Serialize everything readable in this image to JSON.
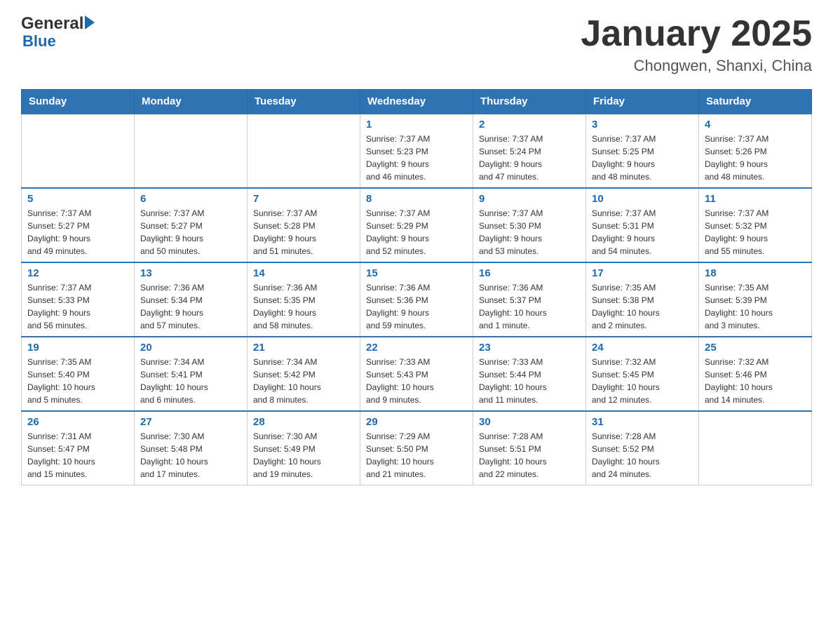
{
  "header": {
    "logo_general": "General",
    "logo_blue": "Blue",
    "month_title": "January 2025",
    "location": "Chongwen, Shanxi, China"
  },
  "days_of_week": [
    "Sunday",
    "Monday",
    "Tuesday",
    "Wednesday",
    "Thursday",
    "Friday",
    "Saturday"
  ],
  "weeks": [
    [
      {
        "day": "",
        "info": ""
      },
      {
        "day": "",
        "info": ""
      },
      {
        "day": "",
        "info": ""
      },
      {
        "day": "1",
        "info": "Sunrise: 7:37 AM\nSunset: 5:23 PM\nDaylight: 9 hours\nand 46 minutes."
      },
      {
        "day": "2",
        "info": "Sunrise: 7:37 AM\nSunset: 5:24 PM\nDaylight: 9 hours\nand 47 minutes."
      },
      {
        "day": "3",
        "info": "Sunrise: 7:37 AM\nSunset: 5:25 PM\nDaylight: 9 hours\nand 48 minutes."
      },
      {
        "day": "4",
        "info": "Sunrise: 7:37 AM\nSunset: 5:26 PM\nDaylight: 9 hours\nand 48 minutes."
      }
    ],
    [
      {
        "day": "5",
        "info": "Sunrise: 7:37 AM\nSunset: 5:27 PM\nDaylight: 9 hours\nand 49 minutes."
      },
      {
        "day": "6",
        "info": "Sunrise: 7:37 AM\nSunset: 5:27 PM\nDaylight: 9 hours\nand 50 minutes."
      },
      {
        "day": "7",
        "info": "Sunrise: 7:37 AM\nSunset: 5:28 PM\nDaylight: 9 hours\nand 51 minutes."
      },
      {
        "day": "8",
        "info": "Sunrise: 7:37 AM\nSunset: 5:29 PM\nDaylight: 9 hours\nand 52 minutes."
      },
      {
        "day": "9",
        "info": "Sunrise: 7:37 AM\nSunset: 5:30 PM\nDaylight: 9 hours\nand 53 minutes."
      },
      {
        "day": "10",
        "info": "Sunrise: 7:37 AM\nSunset: 5:31 PM\nDaylight: 9 hours\nand 54 minutes."
      },
      {
        "day": "11",
        "info": "Sunrise: 7:37 AM\nSunset: 5:32 PM\nDaylight: 9 hours\nand 55 minutes."
      }
    ],
    [
      {
        "day": "12",
        "info": "Sunrise: 7:37 AM\nSunset: 5:33 PM\nDaylight: 9 hours\nand 56 minutes."
      },
      {
        "day": "13",
        "info": "Sunrise: 7:36 AM\nSunset: 5:34 PM\nDaylight: 9 hours\nand 57 minutes."
      },
      {
        "day": "14",
        "info": "Sunrise: 7:36 AM\nSunset: 5:35 PM\nDaylight: 9 hours\nand 58 minutes."
      },
      {
        "day": "15",
        "info": "Sunrise: 7:36 AM\nSunset: 5:36 PM\nDaylight: 9 hours\nand 59 minutes."
      },
      {
        "day": "16",
        "info": "Sunrise: 7:36 AM\nSunset: 5:37 PM\nDaylight: 10 hours\nand 1 minute."
      },
      {
        "day": "17",
        "info": "Sunrise: 7:35 AM\nSunset: 5:38 PM\nDaylight: 10 hours\nand 2 minutes."
      },
      {
        "day": "18",
        "info": "Sunrise: 7:35 AM\nSunset: 5:39 PM\nDaylight: 10 hours\nand 3 minutes."
      }
    ],
    [
      {
        "day": "19",
        "info": "Sunrise: 7:35 AM\nSunset: 5:40 PM\nDaylight: 10 hours\nand 5 minutes."
      },
      {
        "day": "20",
        "info": "Sunrise: 7:34 AM\nSunset: 5:41 PM\nDaylight: 10 hours\nand 6 minutes."
      },
      {
        "day": "21",
        "info": "Sunrise: 7:34 AM\nSunset: 5:42 PM\nDaylight: 10 hours\nand 8 minutes."
      },
      {
        "day": "22",
        "info": "Sunrise: 7:33 AM\nSunset: 5:43 PM\nDaylight: 10 hours\nand 9 minutes."
      },
      {
        "day": "23",
        "info": "Sunrise: 7:33 AM\nSunset: 5:44 PM\nDaylight: 10 hours\nand 11 minutes."
      },
      {
        "day": "24",
        "info": "Sunrise: 7:32 AM\nSunset: 5:45 PM\nDaylight: 10 hours\nand 12 minutes."
      },
      {
        "day": "25",
        "info": "Sunrise: 7:32 AM\nSunset: 5:46 PM\nDaylight: 10 hours\nand 14 minutes."
      }
    ],
    [
      {
        "day": "26",
        "info": "Sunrise: 7:31 AM\nSunset: 5:47 PM\nDaylight: 10 hours\nand 15 minutes."
      },
      {
        "day": "27",
        "info": "Sunrise: 7:30 AM\nSunset: 5:48 PM\nDaylight: 10 hours\nand 17 minutes."
      },
      {
        "day": "28",
        "info": "Sunrise: 7:30 AM\nSunset: 5:49 PM\nDaylight: 10 hours\nand 19 minutes."
      },
      {
        "day": "29",
        "info": "Sunrise: 7:29 AM\nSunset: 5:50 PM\nDaylight: 10 hours\nand 21 minutes."
      },
      {
        "day": "30",
        "info": "Sunrise: 7:28 AM\nSunset: 5:51 PM\nDaylight: 10 hours\nand 22 minutes."
      },
      {
        "day": "31",
        "info": "Sunrise: 7:28 AM\nSunset: 5:52 PM\nDaylight: 10 hours\nand 24 minutes."
      },
      {
        "day": "",
        "info": ""
      }
    ]
  ]
}
